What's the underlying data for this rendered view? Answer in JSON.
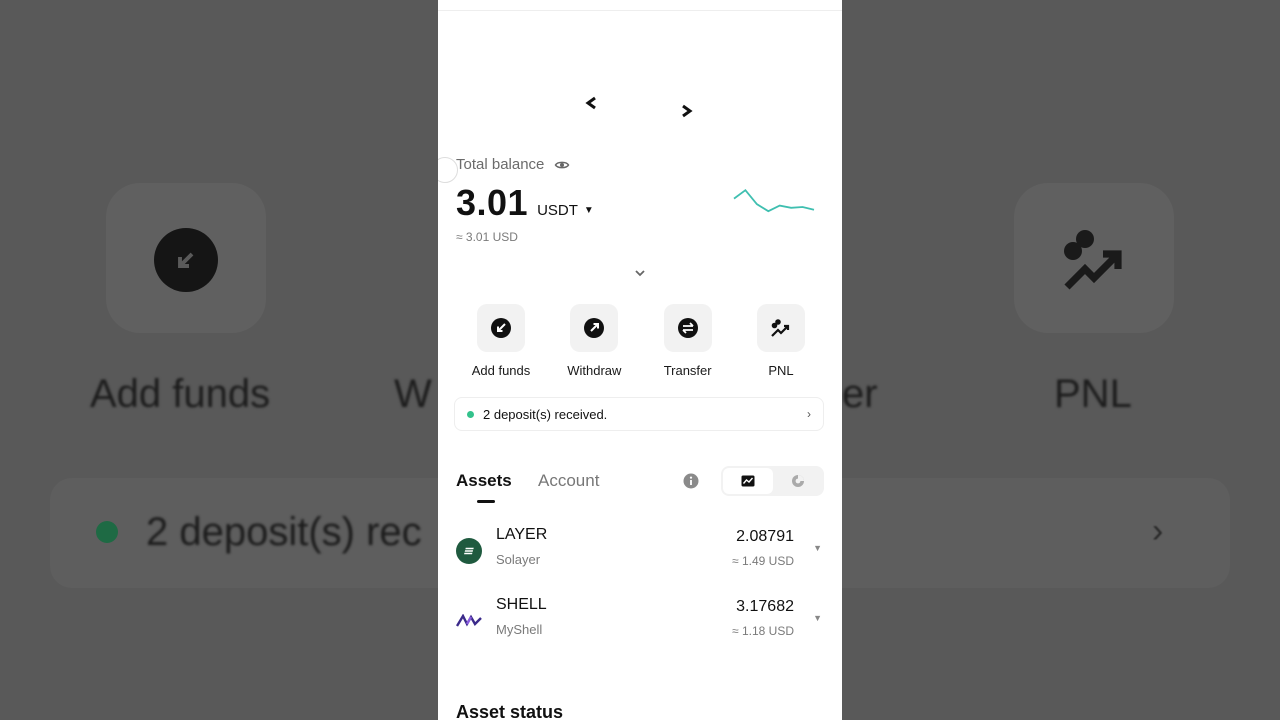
{
  "background": {
    "left_label": "Add funds",
    "left_partial": "W",
    "right_partial": "er",
    "right_label": "PNL",
    "notice_partial": "2 deposit(s) rec"
  },
  "header": {
    "prev_icon": "chevron-left-icon",
    "next_icon": "chevron-right-icon"
  },
  "balance": {
    "label": "Total balance",
    "amount": "3.01",
    "currency": "USDT",
    "approx": "≈ 3.01 USD",
    "trend": [
      0.55,
      0.85,
      0.35,
      0.1,
      0.3,
      0.22,
      0.25,
      0.15
    ],
    "trend_color": "#3fbfb0"
  },
  "actions": [
    {
      "label": "Add funds",
      "icon": "deposit-icon"
    },
    {
      "label": "Withdraw",
      "icon": "withdraw-icon"
    },
    {
      "label": "Transfer",
      "icon": "transfer-icon"
    },
    {
      "label": "PNL",
      "icon": "pnl-icon"
    }
  ],
  "notice": {
    "text": "2 deposit(s) received.",
    "chevron": "›"
  },
  "tabs": {
    "assets": "Assets",
    "account": "Account"
  },
  "assets": [
    {
      "symbol": "LAYER",
      "name": "Solayer",
      "quantity": "2.08791",
      "usd": "≈ 1.49 USD",
      "logo_color": "#1f5a3f"
    },
    {
      "symbol": "SHELL",
      "name": "MyShell",
      "quantity": "3.17682",
      "usd": "≈ 1.18 USD",
      "logo_color": "#3b2a8a"
    }
  ],
  "asset_status": {
    "title": "Asset status"
  }
}
